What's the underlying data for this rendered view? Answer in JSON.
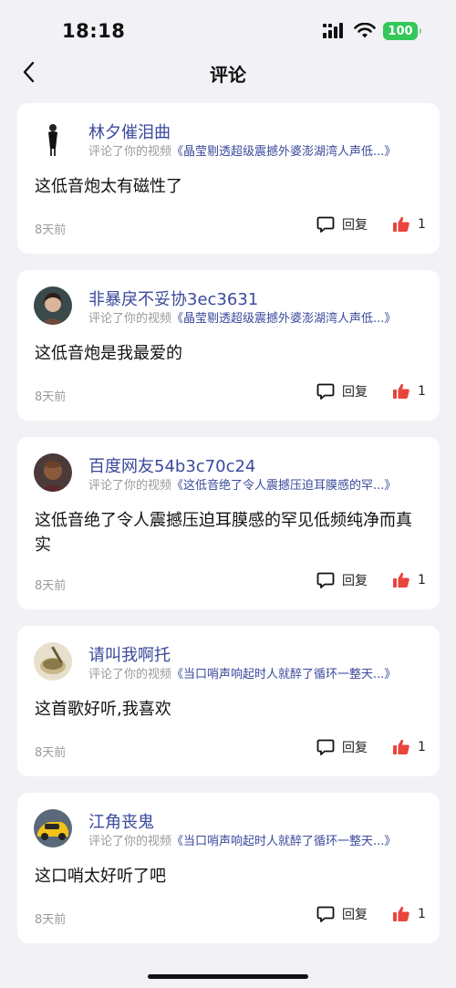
{
  "status": {
    "time": "18:18",
    "battery": "100",
    "icons": [
      "cellular-signal-icon",
      "wifi-icon",
      "battery-icon"
    ]
  },
  "nav": {
    "title": "评论",
    "back_icon": "chevron-left-icon"
  },
  "colors": {
    "accent": "#3b4a9c",
    "like": "#e8453c",
    "battery": "#34c759",
    "background": "#f2f2f6"
  },
  "comments": [
    {
      "name": "林夕催泪曲",
      "prefix": "评论了你的视频",
      "video": "《晶莹剔透超级震撼外婆澎湖湾人声低...》",
      "text": "这低音炮太有磁性了",
      "time": "8天前",
      "reply_label": "回复",
      "likes": "1",
      "avatar": "woman-standing-avatar"
    },
    {
      "name": "非暴戾不妥协3ec3631",
      "prefix": "评论了你的视频",
      "video": "《晶莹剔透超级震撼外婆澎湖湾人声低...》",
      "text": "这低音炮是我最爱的",
      "time": "8天前",
      "reply_label": "回复",
      "likes": "1",
      "avatar": "woman-portrait-avatar"
    },
    {
      "name": "百度网友54b3c70c24",
      "prefix": "评论了你的视频",
      "video": "《这低音绝了令人震撼压迫耳膜感的罕...》",
      "text": "这低音绝了令人震撼压迫耳膜感的罕见低频纯净而真实",
      "time": "8天前",
      "reply_label": "回复",
      "likes": "1",
      "avatar": "man-portrait-avatar"
    },
    {
      "name": "请叫我啊托",
      "prefix": "评论了你的视频",
      "video": "《当口哨声响起时人就醉了循环一整天...》",
      "text": "这首歌好听,我喜欢",
      "time": "8天前",
      "reply_label": "回复",
      "likes": "1",
      "avatar": "tea-cup-avatar"
    },
    {
      "name": "江角丧鬼",
      "prefix": "评论了你的视频",
      "video": "《当口哨声响起时人就醉了循环一整天...》",
      "text": "这口哨太好听了吧",
      "time": "8天前",
      "reply_label": "回复",
      "likes": "1",
      "avatar": "yellow-car-avatar"
    }
  ]
}
